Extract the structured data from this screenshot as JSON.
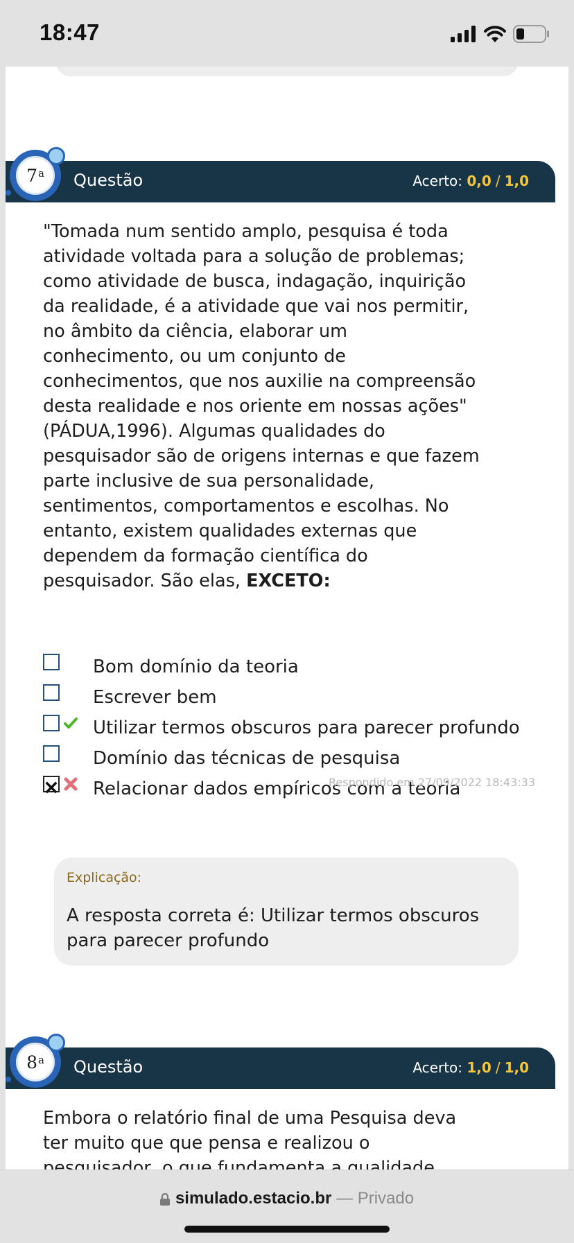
{
  "status_bar": {
    "time": "18:47"
  },
  "questions": [
    {
      "number": "7",
      "ordinal": "a",
      "label": "Questão",
      "score_label": "Acerto:",
      "score_value": "0,0",
      "score_sep": "/",
      "score_max": "1,0",
      "text": "\"Tomada num sentido amplo, pesquisa é toda atividade voltada para a solução de problemas; como atividade de busca, indagação, inquirição da realidade, é a atividade que vai nos permitir, no âmbito da ciência, elaborar um conhecimento, ou um conjunto de conhecimentos, que nos auxilie na compreensão desta realidade e nos oriente em nossas ações\" (PÁDUA,1996). Algumas qualidades do pesquisador são de origens internas e que fazem parte inclusive de sua personalidade, sentimentos, comportamentos e escolhas. No entanto, existem qualidades externas que dependem da formação científica do pesquisador. São elas,",
      "text_emphasis": "EXCETO:",
      "options": [
        {
          "label": "Bom domínio da teoria",
          "checked": false,
          "mark": ""
        },
        {
          "label": "Escrever bem",
          "checked": false,
          "mark": ""
        },
        {
          "label": "Utilizar termos obscuros para parecer profundo",
          "checked": false,
          "mark": "correct"
        },
        {
          "label": "Domínio das técnicas de pesquisa",
          "checked": false,
          "mark": ""
        },
        {
          "label": "Relacionar dados empíricos com a teoria",
          "checked": true,
          "mark": "wrong"
        }
      ],
      "answered_at": "Respondido em 27/09/2022 18:43:33",
      "explanation_label": "Explicação:",
      "explanation_text": "A resposta correta é: Utilizar termos obscuros para parecer profundo"
    },
    {
      "number": "8",
      "ordinal": "a",
      "label": "Questão",
      "score_label": "Acerto:",
      "score_value": "1,0",
      "score_sep": "/",
      "score_max": "1,0",
      "text": "Embora o relatório final de uma Pesquisa deva ter muito que que pensa e realizou o pesquisador, o que fundamenta a qualidade"
    }
  ],
  "browser": {
    "domain": "simulado.estacio.br",
    "separator": "—",
    "mode": "Privado"
  },
  "colors": {
    "header_bg": "#183447",
    "score_accent": "#f4c63d",
    "correct": "#4db82a",
    "wrong": "#e0707a"
  },
  "icons": [
    "signal-icon",
    "wifi-icon",
    "battery-icon",
    "lock-icon",
    "checkmark-icon",
    "cross-icon"
  ]
}
